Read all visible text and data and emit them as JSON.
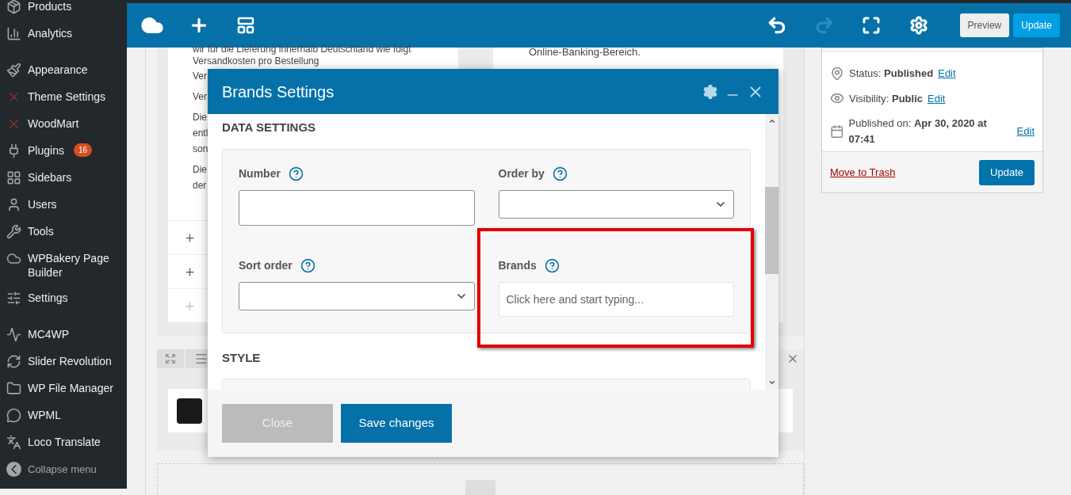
{
  "sidebar": {
    "groups": [
      [
        {
          "label": "Products"
        },
        {
          "label": "Analytics"
        }
      ],
      [
        {
          "label": "Appearance"
        },
        {
          "label": "Theme Settings"
        },
        {
          "label": "WoodMart"
        },
        {
          "label": "Plugins",
          "badge": "16"
        },
        {
          "label": "Sidebars"
        },
        {
          "label": "Users"
        },
        {
          "label": "Tools"
        },
        {
          "label": "WPBakery Page Builder"
        },
        {
          "label": "Settings"
        }
      ],
      [
        {
          "label": "MC4WP"
        },
        {
          "label": "Slider Revolution"
        },
        {
          "label": "WP File Manager"
        },
        {
          "label": "WPML"
        },
        {
          "label": "Loco Translate"
        }
      ]
    ],
    "collapse": "Collapse menu"
  },
  "toolbar": {
    "history": [
      {
        "disabled": false
      },
      {
        "disabled": true
      }
    ],
    "preview": "Preview",
    "update": "Update"
  },
  "editor": {
    "left_text": [
      "wir für die Lieferung innerhalb Deutschland wie folgt Versandkosten pro Bestellung",
      "Ver",
      "Ver",
      "Die",
      "entl",
      "son",
      "Die",
      "der"
    ],
    "accordion": [
      {
        "disabled": false
      },
      {
        "disabled": false
      },
      {
        "disabled": true
      }
    ],
    "right_text": "Online-Banking-Bereich."
  },
  "publish": {
    "rows": [
      {
        "label": "Status:",
        "value": "Published",
        "link": "Edit"
      },
      {
        "label": "Visibility:",
        "value": "Public",
        "link": "Edit"
      },
      {
        "label": "Published on:",
        "value": "Apr 30, 2020 at 07:41",
        "link": "Edit"
      }
    ],
    "trash": "Move to Trash",
    "update": "Update"
  },
  "modal": {
    "title": "Brands Settings",
    "sections": [
      {
        "heading": "DATA SETTINGS",
        "fields": [
          {
            "label": "Number",
            "kind": "text",
            "highlighted": false
          },
          {
            "label": "Order by",
            "kind": "select",
            "highlighted": false
          },
          {
            "label": "Sort order",
            "kind": "select",
            "highlighted": false
          },
          {
            "label": "Brands",
            "kind": "text",
            "placeholder": "Click here and start typing...",
            "highlighted": true
          }
        ]
      },
      {
        "heading": "STYLE"
      }
    ],
    "buttons": [
      {
        "label": "Close",
        "kind": "secondary"
      },
      {
        "label": "Save changes",
        "kind": "primary"
      }
    ]
  }
}
